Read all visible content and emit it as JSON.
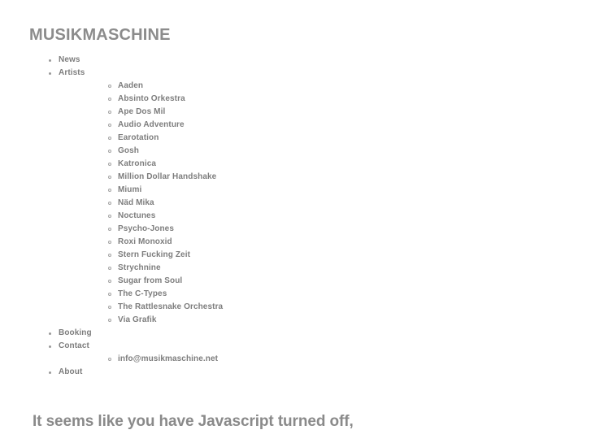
{
  "site": {
    "title": "MUSIKMASCHINE",
    "title_color": "#8c8c8c",
    "background_color": "#ffffff",
    "text_color": "#7d7d7d"
  },
  "nav": {
    "items": [
      {
        "label": "News",
        "children": []
      },
      {
        "label": "Artists",
        "children": [
          {
            "label": "Aaden"
          },
          {
            "label": "Absinto Orkestra"
          },
          {
            "label": "Ape Dos Mil"
          },
          {
            "label": "Audio Adventure"
          },
          {
            "label": "Earotation"
          },
          {
            "label": "Gosh"
          },
          {
            "label": "Katronica"
          },
          {
            "label": "Million Dollar Handshake"
          },
          {
            "label": "Miumi"
          },
          {
            "label": "Näd Mika"
          },
          {
            "label": "Noctunes"
          },
          {
            "label": "Psycho-Jones"
          },
          {
            "label": "Roxi Monoxid"
          },
          {
            "label": "Stern Fucking Zeit"
          },
          {
            "label": "Strychnine"
          },
          {
            "label": "Sugar from Soul"
          },
          {
            "label": "The C-Types"
          },
          {
            "label": "The Rattlesnake Orchestra"
          },
          {
            "label": "Via Grafik"
          }
        ]
      },
      {
        "label": "Booking",
        "children": []
      },
      {
        "label": "Contact",
        "children": [
          {
            "label": "info@musikmaschine.net"
          }
        ]
      },
      {
        "label": "About",
        "children": []
      }
    ]
  },
  "notice": {
    "heading": "It seems like you have Javascript turned off,"
  }
}
